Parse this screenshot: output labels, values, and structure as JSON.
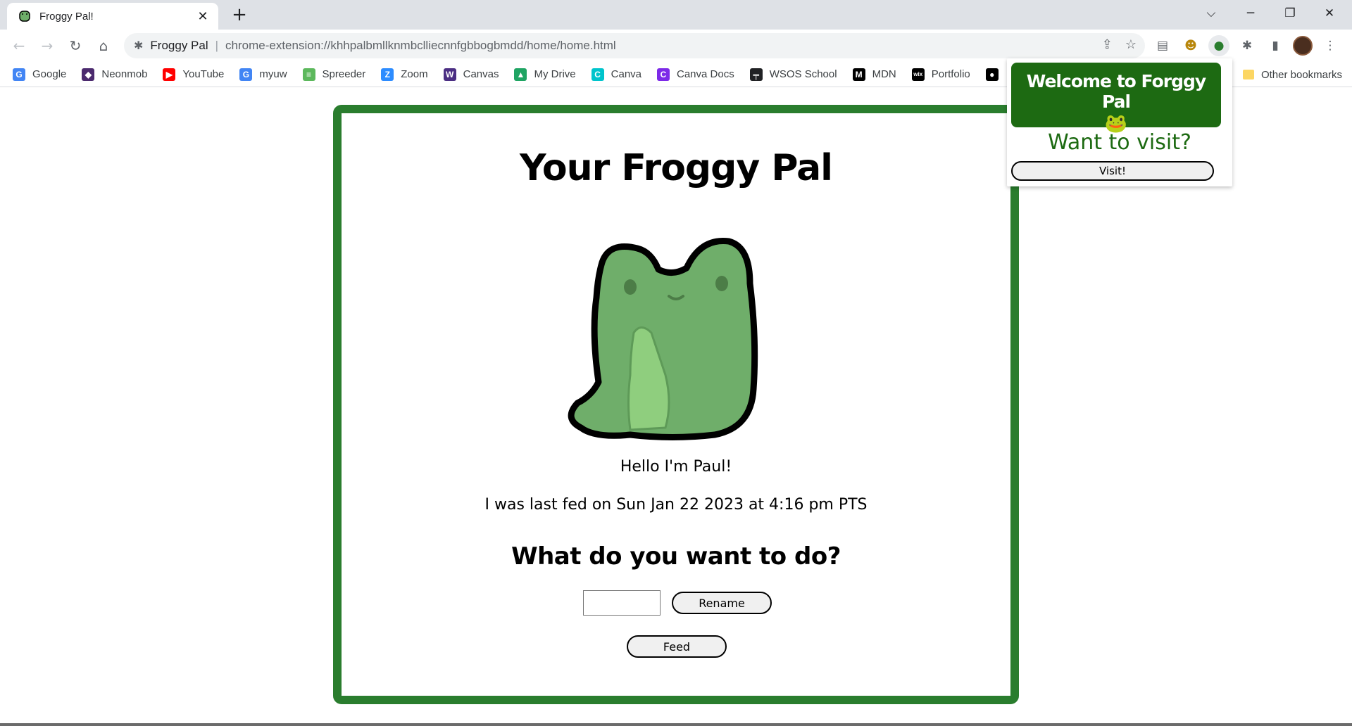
{
  "browser": {
    "tab_title": "Froggy Pal!",
    "site_name": "Froggy Pal",
    "url": "chrome-extension://khhpalbmllknmbclliecnnfgbbogbmdd/home/home.html"
  },
  "bookmarks": [
    {
      "label": "Google",
      "icon": "google-icon",
      "color": "#4285f4",
      "glyph": "G"
    },
    {
      "label": "Neonmob",
      "icon": "neonmob-icon",
      "color": "#4b2a6e",
      "glyph": "◆"
    },
    {
      "label": "YouTube",
      "icon": "youtube-icon",
      "color": "#ff0000",
      "glyph": "▶"
    },
    {
      "label": "myuw",
      "icon": "google-icon",
      "color": "#4285f4",
      "glyph": "G"
    },
    {
      "label": "Spreeder",
      "icon": "spreeder-icon",
      "color": "#5cb85c",
      "glyph": "≡"
    },
    {
      "label": "Zoom",
      "icon": "zoom-icon",
      "color": "#2d8cff",
      "glyph": "Z"
    },
    {
      "label": "Canvas",
      "icon": "canvas-uw-icon",
      "color": "#4b2e83",
      "glyph": "W"
    },
    {
      "label": "My Drive",
      "icon": "drive-icon",
      "color": "#1fa463",
      "glyph": "▲"
    },
    {
      "label": "Canva",
      "icon": "canva-icon",
      "color": "#00c4cc",
      "glyph": "C"
    },
    {
      "label": "Canva Docs",
      "icon": "canva-icon",
      "color": "#7d2ae8",
      "glyph": "C"
    },
    {
      "label": "WSOS School",
      "icon": "wsos-icon",
      "color": "#202124",
      "glyph": "╤"
    },
    {
      "label": "MDN",
      "icon": "mdn-icon",
      "color": "#000000",
      "glyph": "M"
    },
    {
      "label": "Portfolio",
      "icon": "wix-icon",
      "color": "#000000",
      "glyph": "wix"
    },
    {
      "label": "",
      "icon": "github-icon",
      "color": "#000000",
      "glyph": "●"
    }
  ],
  "other_bookmarks": "Other bookmarks",
  "page": {
    "title": "Your Froggy Pal",
    "hello": "Hello I'm Paul!",
    "last_fed": "I was last fed on Sun Jan 22 2023 at 4:16 pm PTS",
    "question": "What do you want to do?",
    "rename_value": "",
    "rename_label": "Rename",
    "feed_label": "Feed"
  },
  "popup": {
    "title": "Welcome to Forggy Pal",
    "emoji": "🐸",
    "question": "Want to visit?",
    "visit_label": "Visit!"
  },
  "colors": {
    "frame_green": "#2a7d2e",
    "popup_green": "#1d6a12",
    "frog_green": "#6fae6a"
  }
}
